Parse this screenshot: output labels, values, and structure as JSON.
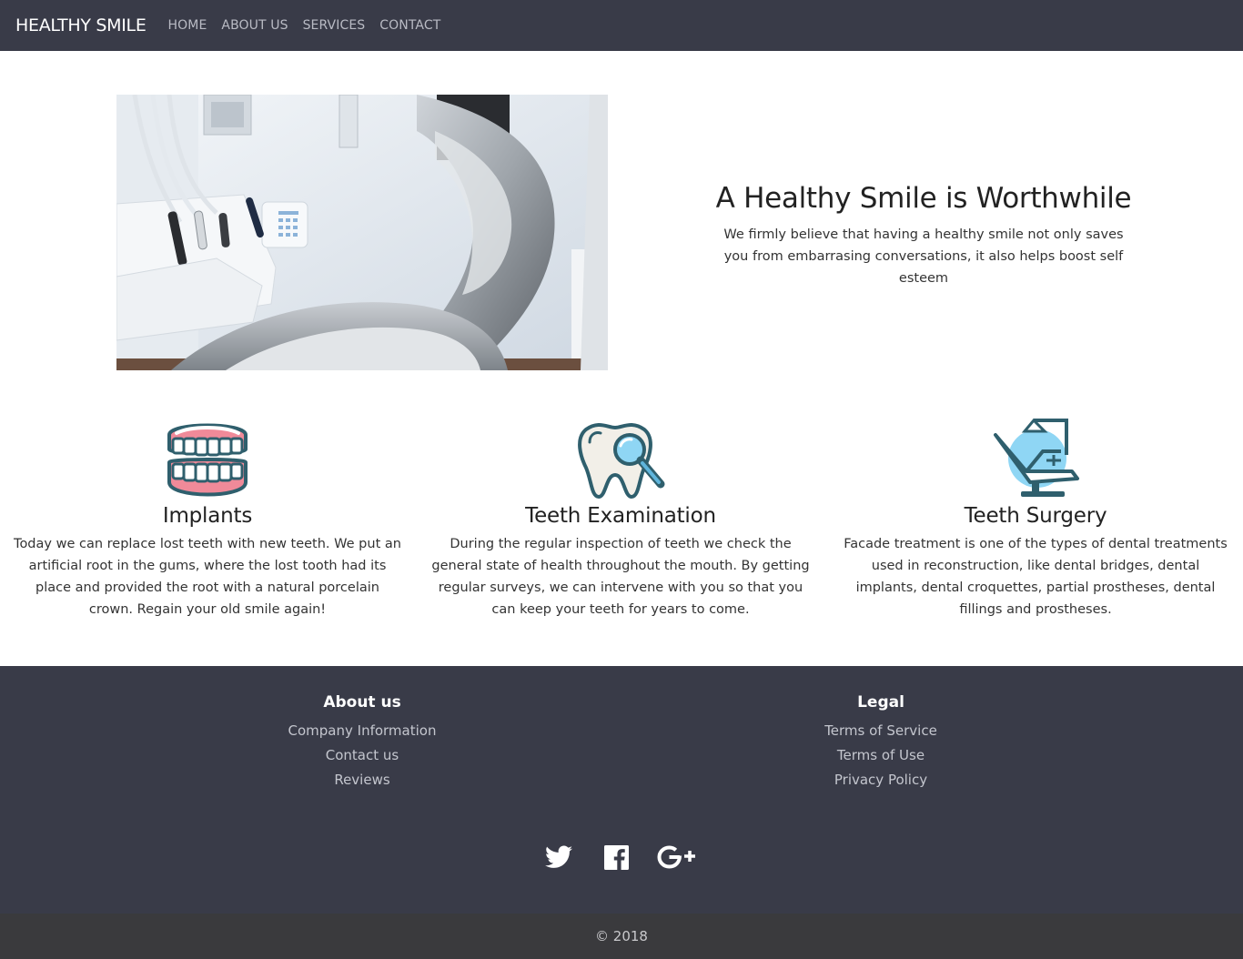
{
  "nav": {
    "brand": "HEALTHY SMILE",
    "links": [
      "HOME",
      "ABOUT US",
      "SERVICES",
      "CONTACT"
    ]
  },
  "hero": {
    "title": "A Healthy Smile is Worthwhile",
    "subtitle": "We firmly believe that having a healthy smile not only saves you from embarrasing conversations, it also helps boost self esteem"
  },
  "services": [
    {
      "icon": "dentures-icon",
      "title": "Implants",
      "text": "Today we can replace lost teeth with new teeth. We put an artificial root in the gums, where the lost tooth had its place and provided the root with a natural porcelain crown. Regain your old smile again!"
    },
    {
      "icon": "tooth-magnifier-icon",
      "title": "Teeth Examination",
      "text": "During the regular inspection of teeth we check the general state of health throughout the mouth. By getting regular surveys, we can intervene with you so that you can keep your teeth for years to come."
    },
    {
      "icon": "dental-chair-icon",
      "title": "Teeth Surgery",
      "text": "Facade treatment is one of the types of dental treatments used in reconstruction, like dental bridges, dental implants, dental croquettes, partial prostheses, dental fillings and prostheses."
    }
  ],
  "footer": {
    "about": {
      "heading": "About us",
      "links": [
        "Company Information",
        "Contact us",
        "Reviews"
      ]
    },
    "legal": {
      "heading": "Legal",
      "links": [
        "Terms of Service",
        "Terms of Use",
        "Privacy Policy"
      ]
    },
    "socials": [
      "twitter-icon",
      "facebook-icon",
      "google-plus-icon"
    ]
  },
  "copyright": "© 2018",
  "colors": {
    "navbar": "#393b48",
    "footer": "#393b48",
    "copyright_bar": "#3a3a3d",
    "icon_teal": "#2f5f6d",
    "icon_pink": "#f08a99",
    "icon_blue": "#8fd6f4"
  }
}
